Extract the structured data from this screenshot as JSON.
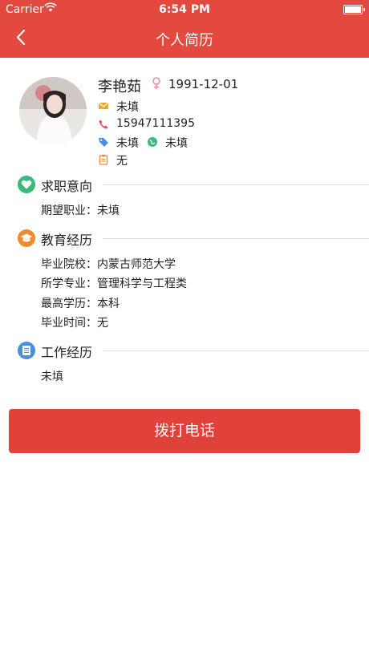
{
  "status_bar": {
    "carrier": "Carrier",
    "time": "6:54 PM"
  },
  "nav": {
    "title": "个人简历"
  },
  "profile": {
    "name": "李艳茹",
    "birthday": "1991-12-01",
    "email": "未填",
    "phone": "15947111395",
    "tag": "未填",
    "web": "未填",
    "note": "无"
  },
  "sections": {
    "intention": {
      "title": "求职意向",
      "fields": [
        {
          "key": "期望职业：",
          "value": "未填"
        }
      ]
    },
    "education": {
      "title": "教育经历",
      "fields": [
        {
          "key": "毕业院校：",
          "value": "内蒙古师范大学"
        },
        {
          "key": "所学专业：",
          "value": "管理科学与工程类"
        },
        {
          "key": "最高学历：",
          "value": "本科"
        },
        {
          "key": "毕业时间：",
          "value": "无"
        }
      ]
    },
    "work": {
      "title": "工作经历",
      "text": "未填"
    }
  },
  "call_button": {
    "label": "拨打电话"
  },
  "colors": {
    "header": "#e3493e",
    "button": "#e04139",
    "intention_badge": "#3cb87a",
    "education_badge": "#f08a2e",
    "work_badge": "#4a8fdf"
  }
}
